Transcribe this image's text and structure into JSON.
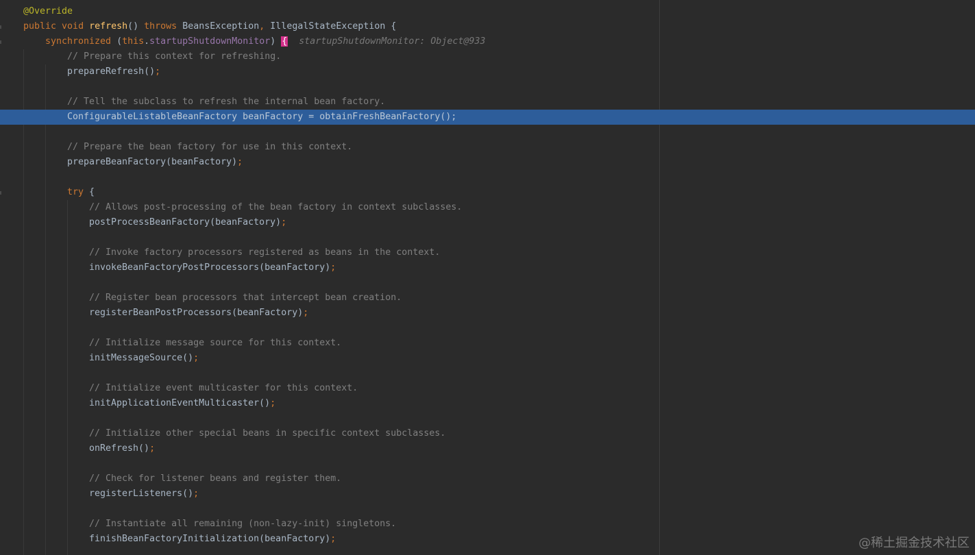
{
  "theme_colors": {
    "background": "#2b2b2b",
    "selection_line": "#2d5d9a",
    "brace_match": "#d32f8a",
    "keyword": "#cc7832",
    "annotation": "#bbb529",
    "method": "#ffc66d",
    "field": "#9876aa",
    "comment": "#808080",
    "text": "#a9b7c6"
  },
  "editor": {
    "highlighted_line_index": 7,
    "lines": [
      {
        "indent": 0,
        "tokens": [
          {
            "t": "annotation",
            "v": "@Override"
          }
        ]
      },
      {
        "indent": 0,
        "tokens": [
          {
            "t": "kw",
            "v": "public "
          },
          {
            "t": "kw",
            "v": "void "
          },
          {
            "t": "fn",
            "v": "refresh"
          },
          {
            "t": "text",
            "v": "() "
          },
          {
            "t": "kw",
            "v": "throws "
          },
          {
            "t": "text",
            "v": "BeansException"
          },
          {
            "t": "punct",
            "v": ", "
          },
          {
            "t": "text",
            "v": "IllegalStateException {"
          }
        ]
      },
      {
        "indent": 1,
        "tokens": [
          {
            "t": "kw",
            "v": "synchronized "
          },
          {
            "t": "text",
            "v": "("
          },
          {
            "t": "kw",
            "v": "this"
          },
          {
            "t": "text",
            "v": "."
          },
          {
            "t": "field",
            "v": "startupShutdownMonitor"
          },
          {
            "t": "text",
            "v": ") "
          },
          {
            "t": "brace",
            "v": "{"
          },
          {
            "t": "hint",
            "v": "startupShutdownMonitor: Object@933"
          }
        ]
      },
      {
        "indent": 2,
        "tokens": [
          {
            "t": "comment",
            "v": "// Prepare this context for refreshing."
          }
        ]
      },
      {
        "indent": 2,
        "tokens": [
          {
            "t": "text",
            "v": "prepareRefresh()"
          },
          {
            "t": "punct",
            "v": ";"
          }
        ]
      },
      {
        "indent": 2,
        "tokens": []
      },
      {
        "indent": 2,
        "tokens": [
          {
            "t": "comment",
            "v": "// Tell the subclass to refresh the internal bean factory."
          }
        ]
      },
      {
        "indent": 2,
        "tokens": [
          {
            "t": "text",
            "v": "ConfigurableListableBeanFactory beanFactory = obtainFreshBeanFactory()"
          },
          {
            "t": "punct",
            "v": ";"
          }
        ]
      },
      {
        "indent": 2,
        "tokens": []
      },
      {
        "indent": 2,
        "tokens": [
          {
            "t": "comment",
            "v": "// Prepare the bean factory for use in this context."
          }
        ]
      },
      {
        "indent": 2,
        "tokens": [
          {
            "t": "text",
            "v": "prepareBeanFactory(beanFactory)"
          },
          {
            "t": "punct",
            "v": ";"
          }
        ]
      },
      {
        "indent": 2,
        "tokens": []
      },
      {
        "indent": 2,
        "tokens": [
          {
            "t": "kw",
            "v": "try "
          },
          {
            "t": "text",
            "v": "{"
          }
        ]
      },
      {
        "indent": 3,
        "tokens": [
          {
            "t": "comment",
            "v": "// Allows post-processing of the bean factory in context subclasses."
          }
        ]
      },
      {
        "indent": 3,
        "tokens": [
          {
            "t": "text",
            "v": "postProcessBeanFactory(beanFactory)"
          },
          {
            "t": "punct",
            "v": ";"
          }
        ]
      },
      {
        "indent": 3,
        "tokens": []
      },
      {
        "indent": 3,
        "tokens": [
          {
            "t": "comment",
            "v": "// Invoke factory processors registered as beans in the context."
          }
        ]
      },
      {
        "indent": 3,
        "tokens": [
          {
            "t": "text",
            "v": "invokeBeanFactoryPostProcessors(beanFactory)"
          },
          {
            "t": "punct",
            "v": ";"
          }
        ]
      },
      {
        "indent": 3,
        "tokens": []
      },
      {
        "indent": 3,
        "tokens": [
          {
            "t": "comment",
            "v": "// Register bean processors that intercept bean creation."
          }
        ]
      },
      {
        "indent": 3,
        "tokens": [
          {
            "t": "text",
            "v": "registerBeanPostProcessors(beanFactory)"
          },
          {
            "t": "punct",
            "v": ";"
          }
        ]
      },
      {
        "indent": 3,
        "tokens": []
      },
      {
        "indent": 3,
        "tokens": [
          {
            "t": "comment",
            "v": "// Initialize message source for this context."
          }
        ]
      },
      {
        "indent": 3,
        "tokens": [
          {
            "t": "text",
            "v": "initMessageSource()"
          },
          {
            "t": "punct",
            "v": ";"
          }
        ]
      },
      {
        "indent": 3,
        "tokens": []
      },
      {
        "indent": 3,
        "tokens": [
          {
            "t": "comment",
            "v": "// Initialize event multicaster for this context."
          }
        ]
      },
      {
        "indent": 3,
        "tokens": [
          {
            "t": "text",
            "v": "initApplicationEventMulticaster()"
          },
          {
            "t": "punct",
            "v": ";"
          }
        ]
      },
      {
        "indent": 3,
        "tokens": []
      },
      {
        "indent": 3,
        "tokens": [
          {
            "t": "comment",
            "v": "// Initialize other special beans in specific context subclasses."
          }
        ]
      },
      {
        "indent": 3,
        "tokens": [
          {
            "t": "text",
            "v": "onRefresh()"
          },
          {
            "t": "punct",
            "v": ";"
          }
        ]
      },
      {
        "indent": 3,
        "tokens": []
      },
      {
        "indent": 3,
        "tokens": [
          {
            "t": "comment",
            "v": "// Check for listener beans and register them."
          }
        ]
      },
      {
        "indent": 3,
        "tokens": [
          {
            "t": "text",
            "v": "registerListeners()"
          },
          {
            "t": "punct",
            "v": ";"
          }
        ]
      },
      {
        "indent": 3,
        "tokens": []
      },
      {
        "indent": 3,
        "tokens": [
          {
            "t": "comment",
            "v": "// Instantiate all remaining (non-lazy-init) singletons."
          }
        ]
      },
      {
        "indent": 3,
        "tokens": [
          {
            "t": "text",
            "v": "finishBeanFactoryInitialization(beanFactory)"
          },
          {
            "t": "punct",
            "v": ";"
          }
        ]
      }
    ]
  },
  "watermark": {
    "text": "@稀土掘金技术社区"
  }
}
